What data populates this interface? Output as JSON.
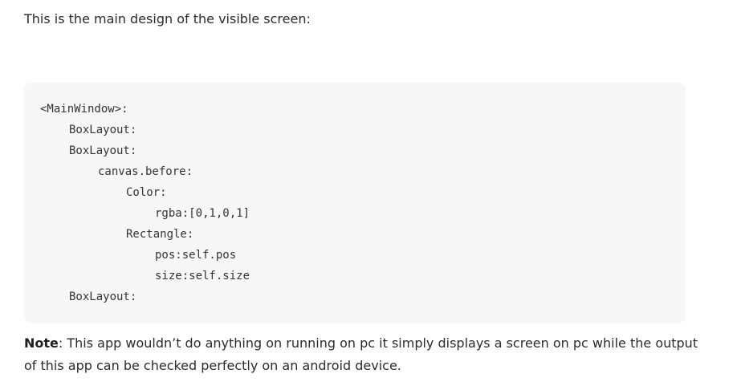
{
  "intro": {
    "text": "This is the main design of the visible screen:"
  },
  "code": {
    "lines": [
      "<MainWindow>:",
      "BoxLayout:",
      "BoxLayout:",
      "canvas.before:",
      "Color:",
      "rgba:[0,1,0,1]",
      "Rectangle:",
      "pos:self.pos",
      "size:self.size",
      "BoxLayout:"
    ]
  },
  "note": {
    "label": "Note",
    "text": ": This app wouldn’t do anything on running on pc it simply displays a screen on pc while the output of this app can be checked perfectly on an android device."
  }
}
